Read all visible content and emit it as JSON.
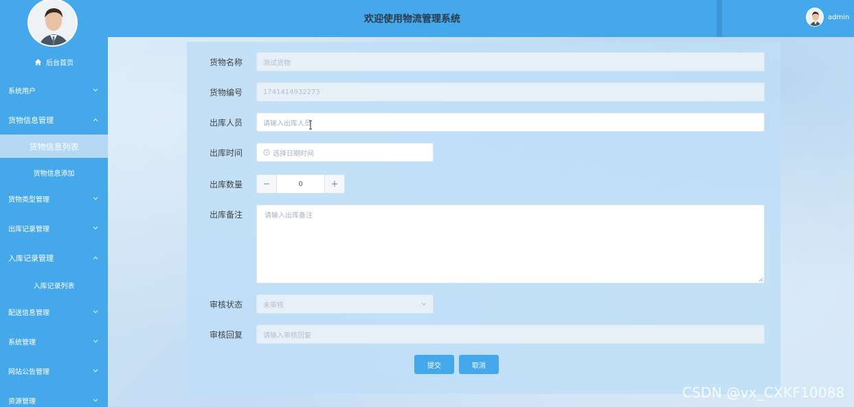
{
  "header": {
    "title": "欢迎使用物流管理系统",
    "username": "admin"
  },
  "sidebar": {
    "home_label": "后台首页",
    "menu": [
      {
        "label": "系统用户"
      },
      {
        "label": "货物信息管理",
        "sub": [
          "货物信息列表",
          "货物信息添加"
        ]
      },
      {
        "label": "货物类型管理"
      },
      {
        "label": "出库记录管理"
      },
      {
        "label": "入库记录管理",
        "sub": [
          "入库记录列表"
        ]
      },
      {
        "label": "配送信息管理"
      },
      {
        "label": "系统管理"
      },
      {
        "label": "网站公告管理"
      },
      {
        "label": "资源管理"
      }
    ]
  },
  "form": {
    "goods_name": {
      "label": "货物名称",
      "value": "测试货物"
    },
    "goods_no": {
      "label": "货物编号",
      "value": "1741414932273"
    },
    "out_person": {
      "label": "出库人员",
      "placeholder": "请输入出库人员"
    },
    "out_time": {
      "label": "出库时间",
      "placeholder": "选择日期时间"
    },
    "out_qty": {
      "label": "出库数量",
      "value": "0",
      "minus": "−",
      "plus": "+"
    },
    "out_note": {
      "label": "出库备注",
      "placeholder": "请输入出库备注"
    },
    "audit_status": {
      "label": "审核状态",
      "value": "未审核"
    },
    "audit_reply": {
      "label": "审核回复",
      "placeholder": "请输入审核回复"
    },
    "submit_label": "提交",
    "cancel_label": "取消"
  },
  "watermark": "CSDN @vx_CXKF10088",
  "colors": {
    "primary": "#45a8eb",
    "panel": "#bedef6",
    "active_item": "#b5d9f4"
  }
}
